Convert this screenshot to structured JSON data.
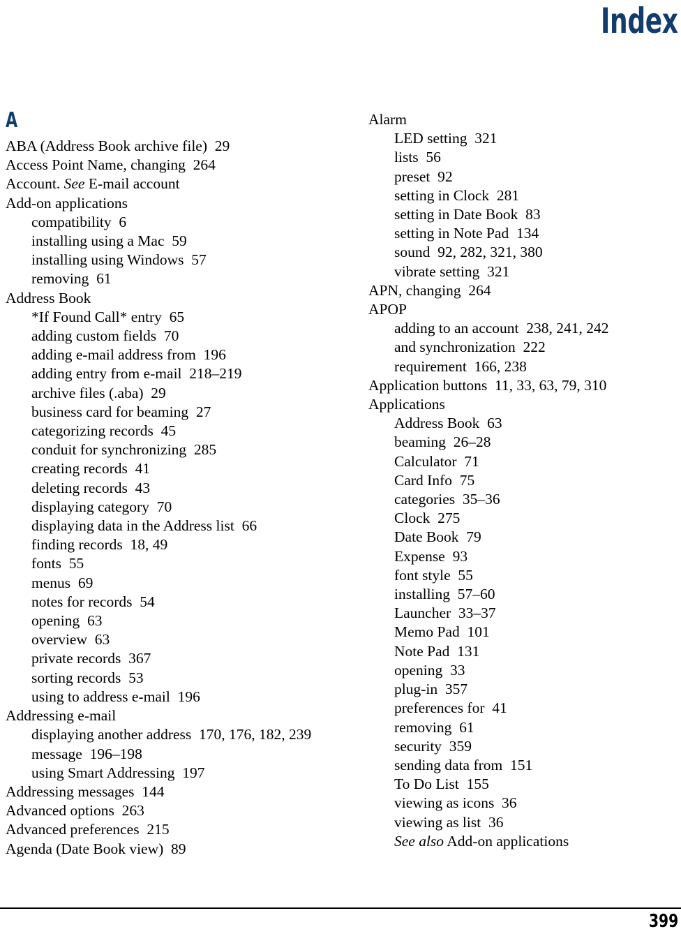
{
  "page": {
    "title": "Index",
    "page_number": "399",
    "title_color": "#123c6b",
    "heading_color": "#123c6b",
    "text_color": "#000000",
    "background_color": "#ffffff"
  },
  "columns": [
    {
      "name": "left-column",
      "letter_heading": "A",
      "entries": [
        {
          "level": 0,
          "text": "ABA (Address Book archive file)  29"
        },
        {
          "level": 0,
          "text": "Access Point Name, changing  264"
        },
        {
          "level": 0,
          "text": "Account. ",
          "italic": "See",
          "after": " E-mail account"
        },
        {
          "level": 0,
          "text": "Add-on applications"
        },
        {
          "level": 1,
          "text": "compatibility  6"
        },
        {
          "level": 1,
          "text": "installing using a Mac  59"
        },
        {
          "level": 1,
          "text": "installing using Windows  57"
        },
        {
          "level": 1,
          "text": "removing  61"
        },
        {
          "level": 0,
          "text": "Address Book"
        },
        {
          "level": 1,
          "text": "*If Found Call* entry  65"
        },
        {
          "level": 1,
          "text": "adding custom fields  70"
        },
        {
          "level": 1,
          "text": "adding e-mail address from  196"
        },
        {
          "level": 1,
          "text": "adding entry from e-mail  218–219"
        },
        {
          "level": 1,
          "text": "archive files (.aba)  29"
        },
        {
          "level": 1,
          "text": "business card for beaming  27"
        },
        {
          "level": 1,
          "text": "categorizing records  45"
        },
        {
          "level": 1,
          "text": "conduit for synchronizing  285"
        },
        {
          "level": 1,
          "text": "creating records  41"
        },
        {
          "level": 1,
          "text": "deleting records  43"
        },
        {
          "level": 1,
          "text": "displaying category  70"
        },
        {
          "level": 1,
          "text": "displaying data in the Address list  66"
        },
        {
          "level": 1,
          "text": "finding records  18, 49"
        },
        {
          "level": 1,
          "text": "fonts  55"
        },
        {
          "level": 1,
          "text": "menus  69"
        },
        {
          "level": 1,
          "text": "notes for records  54"
        },
        {
          "level": 1,
          "text": "opening  63"
        },
        {
          "level": 1,
          "text": "overview  63"
        },
        {
          "level": 1,
          "text": "private records  367"
        },
        {
          "level": 1,
          "text": "sorting records  53"
        },
        {
          "level": 1,
          "text": "using to address e-mail  196"
        },
        {
          "level": 0,
          "text": "Addressing e-mail"
        },
        {
          "level": 1,
          "wrap": true,
          "text": "displaying another address  170, 176, 182, 239"
        },
        {
          "level": 1,
          "text": "message  196–198"
        },
        {
          "level": 1,
          "text": "using Smart Addressing  197"
        },
        {
          "level": 0,
          "text": "Addressing messages  144"
        },
        {
          "level": 0,
          "text": "Advanced options  263"
        },
        {
          "level": 0,
          "text": "Advanced preferences  215"
        },
        {
          "level": 0,
          "text": "Agenda (Date Book view)  89"
        }
      ]
    },
    {
      "name": "right-column",
      "letter_heading": "",
      "entries": [
        {
          "level": 0,
          "text": "Alarm"
        },
        {
          "level": 1,
          "text": "LED setting  321"
        },
        {
          "level": 1,
          "text": "lists  56"
        },
        {
          "level": 1,
          "text": "preset  92"
        },
        {
          "level": 1,
          "text": "setting in Clock  281"
        },
        {
          "level": 1,
          "text": "setting in Date Book  83"
        },
        {
          "level": 1,
          "text": "setting in Note Pad  134"
        },
        {
          "level": 1,
          "text": "sound  92, 282, 321, 380"
        },
        {
          "level": 1,
          "text": "vibrate setting  321"
        },
        {
          "level": 0,
          "text": "APN, changing  264"
        },
        {
          "level": 0,
          "text": "APOP"
        },
        {
          "level": 1,
          "text": "adding to an account  238, 241, 242"
        },
        {
          "level": 1,
          "text": "and synchronization  222"
        },
        {
          "level": 1,
          "text": "requirement  166, 238"
        },
        {
          "level": 0,
          "text": "Application buttons  11, 33, 63, 79, 310"
        },
        {
          "level": 0,
          "text": "Applications"
        },
        {
          "level": 1,
          "text": "Address Book  63"
        },
        {
          "level": 1,
          "text": "beaming  26–28"
        },
        {
          "level": 1,
          "text": "Calculator  71"
        },
        {
          "level": 1,
          "text": "Card Info  75"
        },
        {
          "level": 1,
          "text": "categories  35–36"
        },
        {
          "level": 1,
          "text": "Clock  275"
        },
        {
          "level": 1,
          "text": "Date Book  79"
        },
        {
          "level": 1,
          "text": "Expense  93"
        },
        {
          "level": 1,
          "text": "font style  55"
        },
        {
          "level": 1,
          "text": "installing  57–60"
        },
        {
          "level": 1,
          "text": "Launcher  33–37"
        },
        {
          "level": 1,
          "text": "Memo Pad  101"
        },
        {
          "level": 1,
          "text": "Note Pad  131"
        },
        {
          "level": 1,
          "text": "opening  33"
        },
        {
          "level": 1,
          "text": "plug-in  357"
        },
        {
          "level": 1,
          "text": "preferences for  41"
        },
        {
          "level": 1,
          "text": "removing  61"
        },
        {
          "level": 1,
          "text": "security  359"
        },
        {
          "level": 1,
          "text": "sending data from  151"
        },
        {
          "level": 1,
          "text": "To Do List  155"
        },
        {
          "level": 1,
          "text": "viewing as icons  36"
        },
        {
          "level": 1,
          "text": "viewing as list  36"
        },
        {
          "level": 1,
          "text": "",
          "italic": "See also",
          "after": " Add-on applications"
        }
      ]
    }
  ]
}
